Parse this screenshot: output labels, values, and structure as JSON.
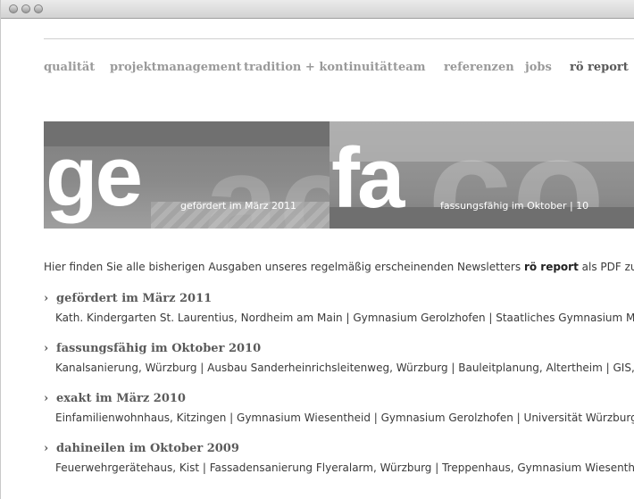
{
  "nav": {
    "items": [
      {
        "label": "qualität"
      },
      {
        "label": "projektmanagement"
      },
      {
        "label": "tradition + kontinuität"
      },
      {
        "label": "team"
      },
      {
        "label": "referenzen"
      },
      {
        "label": "jobs"
      },
      {
        "label": "rö report"
      }
    ]
  },
  "banner": {
    "left": {
      "big": "ge",
      "caption": "gefördert im März 2011"
    },
    "right": {
      "big": "fa",
      "caption": "fassungsfähig im Oktober | 10"
    }
  },
  "intro": {
    "before": "Hier finden Sie alle bisherigen Ausgaben unseres regelmäßig erscheinenden Newsletters ",
    "strong": "rö report",
    "after": " als PDF zum D"
  },
  "issues": [
    {
      "title": "gefördert im März 2011",
      "desc": "Kath. Kindergarten St. Laurentius, Nordheim am Main | Gymnasium Gerolzhofen | Staatliches Gymnasium Mark"
    },
    {
      "title": "fassungsfähig im Oktober 2010",
      "desc": "Kanalsanierung, Würzburg | Ausbau Sanderheinrichsleitenweg, Würzburg | Bauleitplanung, Altertheim | GIS, Nc"
    },
    {
      "title": "exakt im März 2010",
      "desc": "Einfamilienwohnhaus, Kitzingen | Gymnasium Wiesentheid | Gymnasium Gerolzhofen | Universität Würzburg |"
    },
    {
      "title": "dahineilen im Oktober 2009",
      "desc": "Feuerwehrgerätehaus, Kist | Fassadensanierung Flyeralarm, Würzburg | Treppenhaus, Gymnasium Wiesentheid"
    }
  ],
  "colors": {
    "nav": "#9a9a9a",
    "nav_active": "#595959",
    "banner": "#8c8c8c"
  }
}
